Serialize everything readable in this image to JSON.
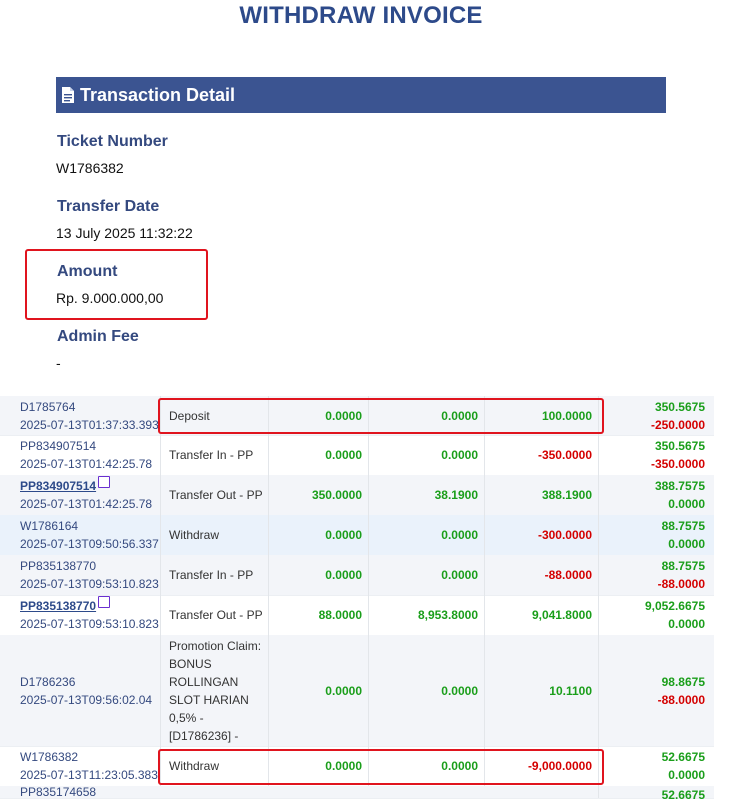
{
  "page": {
    "title": "WITHDRAW INVOICE"
  },
  "transaction_detail": {
    "header": "Transaction Detail",
    "ticket_number": {
      "label": "Ticket Number",
      "value": "W1786382"
    },
    "transfer_date": {
      "label": "Transfer Date",
      "value": "13 July 2025 11:32:22"
    },
    "amount": {
      "label": "Amount",
      "value": "Rp. 9.000.000,00"
    },
    "admin_fee": {
      "label": "Admin Fee",
      "value": "-"
    }
  },
  "transactions": [
    {
      "id": "D1785764",
      "date": "2025-07-13T01:37:33.393",
      "type": "Deposit",
      "n1": "0.0000",
      "n2": "0.0000",
      "n3": "100.0000",
      "bal1": "350.5675",
      "bal2": "-250.0000",
      "highlight": true
    },
    {
      "id": "PP834907514",
      "date": "2025-07-13T01:42:25.78",
      "type": "Transfer In - PP",
      "n1": "0.0000",
      "n2": "0.0000",
      "n3": "-350.0000",
      "bal1": "350.5675",
      "bal2": "-350.0000"
    },
    {
      "id": "PP834907514",
      "date": "2025-07-13T01:42:25.78",
      "type": "Transfer Out - PP",
      "n1": "350.0000",
      "n2": "38.1900",
      "n3": "388.1900",
      "bal1": "388.7575",
      "bal2": "0.0000",
      "linked": true
    },
    {
      "id": "W1786164",
      "date": "2025-07-13T09:50:56.337",
      "type": "Withdraw",
      "n1": "0.0000",
      "n2": "0.0000",
      "n3": "-300.0000",
      "bal1": "88.7575",
      "bal2": "0.0000"
    },
    {
      "id": "PP835138770",
      "date": "2025-07-13T09:53:10.823",
      "type": "Transfer In - PP",
      "n1": "0.0000",
      "n2": "0.0000",
      "n3": "-88.0000",
      "bal1": "88.7575",
      "bal2": "-88.0000"
    },
    {
      "id": "PP835138770",
      "date": "2025-07-13T09:53:10.823",
      "type": "Transfer Out - PP",
      "n1": "88.0000",
      "n2": "8,953.8000",
      "n3": "9,041.8000",
      "bal1": "9,052.6675",
      "bal2": "0.0000",
      "linked": true
    },
    {
      "id": "D1786236",
      "date": "2025-07-13T09:56:02.04",
      "type": "Promotion Claim: BONUS ROLLINGAN SLOT HARIAN 0,5% - [D1786236] -",
      "n1": "0.0000",
      "n2": "0.0000",
      "n3": "10.1100",
      "bal1": "98.8675",
      "bal2": "-88.0000"
    },
    {
      "id": "W1786382",
      "date": "2025-07-13T11:23:05.383",
      "type": "Withdraw",
      "n1": "0.0000",
      "n2": "0.0000",
      "n3": "-9,000.0000",
      "bal1": "52.6675",
      "bal2": "0.0000",
      "highlight": true
    },
    {
      "id": "PP835174658",
      "date": "",
      "type": "",
      "n1": "",
      "n2": "",
      "n3": "",
      "bal1": "52.6675",
      "bal2": ""
    }
  ],
  "colors": {
    "header": "#3b5491",
    "positive": "#1a9e1a",
    "negative": "#d40000",
    "highlight": "#e0141e"
  }
}
